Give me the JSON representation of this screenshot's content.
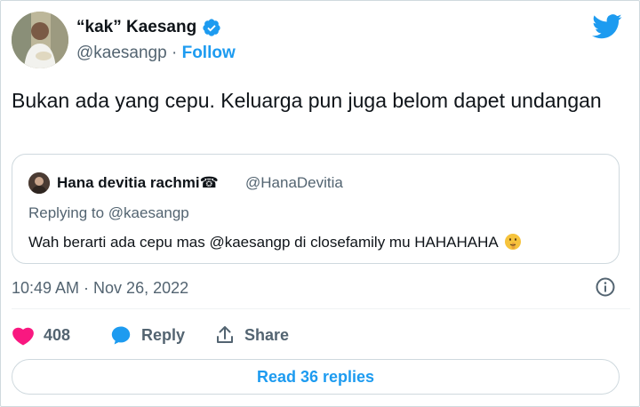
{
  "author": {
    "display_name": "“kak” Kaesang",
    "handle": "@kaesangp",
    "separator": " · ",
    "follow_label": "Follow",
    "verified": true
  },
  "tweet": {
    "text": "Bukan ada yang cepu. Keluarga pun juga belom dapet undangan",
    "timestamp": "10:49 AM · Nov 26, 2022"
  },
  "quoted_tweet": {
    "display_name": "Hana devitia rachmi☎",
    "handle": "@HanaDevitia",
    "replying_to": "Replying to @kaesangp",
    "text": "Wah berarti ada cepu mas @kaesangp di closefamily mu HAHAHAHA",
    "emoji": "shushing-face"
  },
  "actions": {
    "like_count": "408",
    "reply_label": "Reply",
    "share_label": "Share"
  },
  "read_replies_label": "Read 36 replies",
  "colors": {
    "accent": "#1d9bf0",
    "like": "#f91880",
    "text_secondary": "#536471",
    "border": "#cfd9de"
  },
  "icons": [
    "verified-badge-icon",
    "twitter-logo-icon",
    "info-icon",
    "heart-icon",
    "reply-bubble-icon",
    "share-icon"
  ]
}
